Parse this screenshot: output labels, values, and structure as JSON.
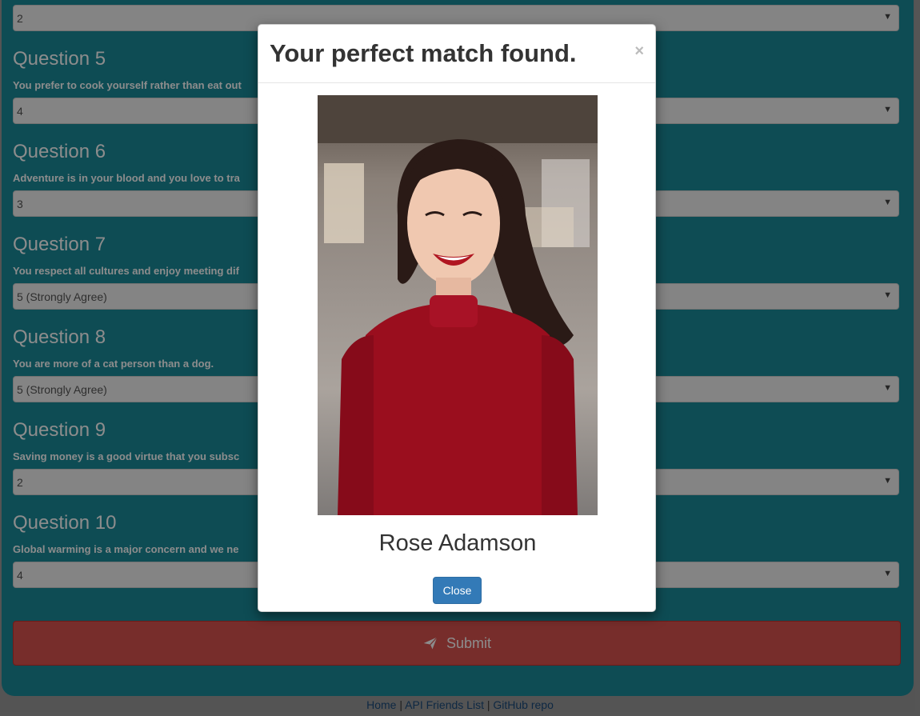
{
  "questions": [
    {
      "title": "",
      "text": "",
      "value": "2"
    },
    {
      "title": "Question 5",
      "text": "You prefer to cook yourself rather than eat out",
      "value": "4"
    },
    {
      "title": "Question 6",
      "text": "Adventure is in your blood and you love to tra",
      "value": "3"
    },
    {
      "title": "Question 7",
      "text": "You respect all cultures and enjoy meeting dif",
      "value": "5 (Strongly Agree)"
    },
    {
      "title": "Question 8",
      "text": "You are more of a cat person than a dog.",
      "value": "5 (Strongly Agree)"
    },
    {
      "title": "Question 9",
      "text": "Saving money is a good virtue that you subsc",
      "value": "2"
    },
    {
      "title": "Question 10",
      "text": "Global warming is a major concern and we ne",
      "value": "4"
    }
  ],
  "submit_label": "Submit",
  "footer": {
    "home": "Home",
    "sep1": " | ",
    "api": "API Friends List",
    "sep2": " | ",
    "github": "GitHub repo"
  },
  "modal": {
    "title": "Your perfect match found.",
    "close_x": "×",
    "name": "Rose Adamson",
    "close_label": "Close"
  },
  "icons": {
    "select_arrow": "▼",
    "submit_icon": "paper-plane-icon"
  }
}
